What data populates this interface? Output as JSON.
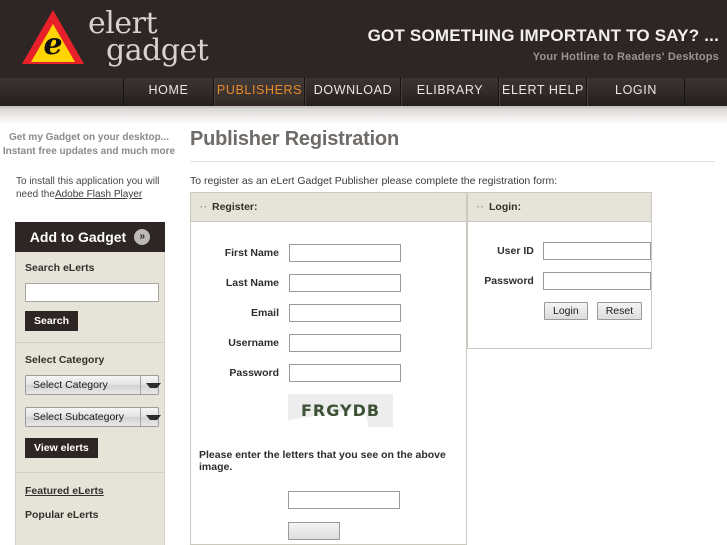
{
  "header": {
    "logo": {
      "icon": "warning-triangle-icon",
      "letter": "e",
      "line1": "elert",
      "line2": "gadget"
    },
    "tagline_main": "GOT SOMETHING IMPORTANT TO SAY? ...",
    "tagline_sub": "Your Hotline to Readers' Desktops"
  },
  "nav": {
    "items": [
      {
        "label": "HOME",
        "active": false
      },
      {
        "label": "PUBLISHERS",
        "active": true
      },
      {
        "label": "DOWNLOAD",
        "active": false
      },
      {
        "label": "ELIBRARY",
        "active": false
      },
      {
        "label": "ELERT HELP",
        "active": false
      },
      {
        "label": "LOGIN",
        "active": false
      }
    ]
  },
  "sidebar": {
    "promo_line1": "Get my Gadget on your desktop...",
    "promo_line2": "Instant free updates and much more",
    "flash_text": "To install this application you will need the",
    "flash_link": "Adobe Flash Player",
    "add_gadget_label": "Add to Gadget",
    "add_gadget_icon": "double-chevron-right-icon",
    "search_label": "Search eLerts",
    "search_value": "",
    "search_button": "Search",
    "category_label": "Select Category",
    "category_selected": "Select Category",
    "subcategory_selected": "Select Subcategory",
    "view_elerts_button": "View elerts",
    "featured_link": "Featured eLerts",
    "popular_link": "Popular eLerts"
  },
  "main": {
    "page_title": "Publisher Registration",
    "intro": "To register as an eLert Gadget Publisher please complete the registration form:",
    "register_panel": {
      "header": "Register:",
      "fields": [
        {
          "label": "First Name",
          "value": ""
        },
        {
          "label": "Last Name",
          "value": ""
        },
        {
          "label": "Email",
          "value": ""
        },
        {
          "label": "Username",
          "value": ""
        },
        {
          "label": "Password",
          "value": ""
        }
      ],
      "captcha_text": "FRGYDB",
      "captcha_note": "Please enter the letters that you see on the above image.",
      "captcha_value": ""
    },
    "login_panel": {
      "header": "Login:",
      "fields": [
        {
          "label": "User ID",
          "value": ""
        },
        {
          "label": "Password",
          "value": ""
        }
      ],
      "login_button": "Login",
      "reset_button": "Reset"
    }
  },
  "colors": {
    "header_bg": "#2e2624",
    "accent_orange": "#e8892b",
    "panel_beige": "#e6e3d9",
    "captcha_green": "#3d5134"
  }
}
